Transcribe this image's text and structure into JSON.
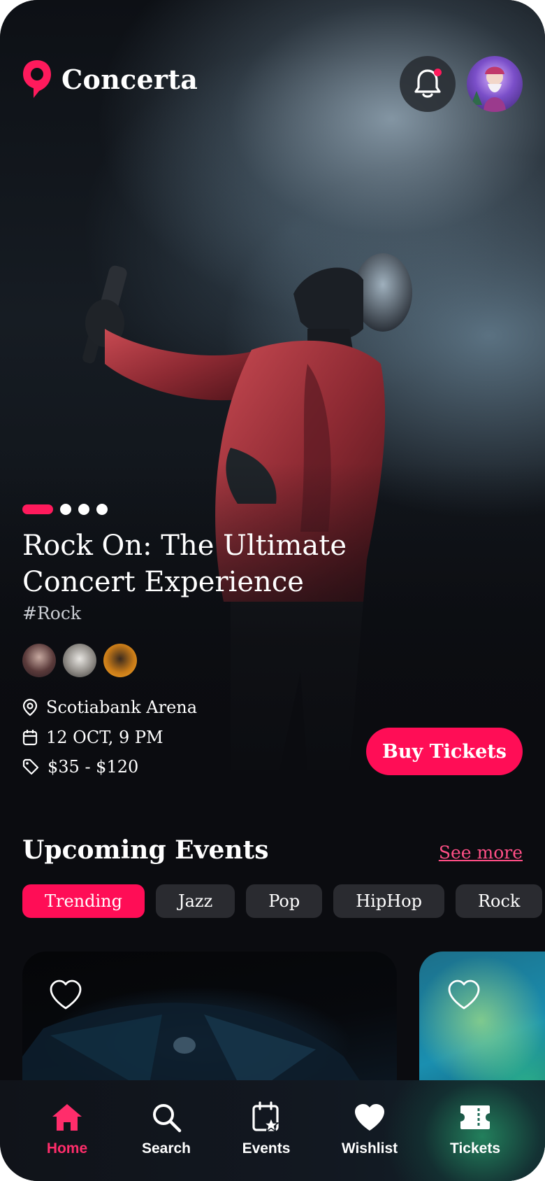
{
  "app": {
    "name": "Concerta"
  },
  "header": {
    "notification_icon": "bell-icon",
    "has_unread": true,
    "profile_icon": "avatar"
  },
  "hero": {
    "slides_total": 4,
    "active_slide": 1,
    "title": "Rock On: The Ultimate Concert Experience",
    "tag": "#Rock",
    "artists": [
      "artist-avatar",
      "artist-avatar",
      "artist-avatar"
    ],
    "venue": "Scotiabank Arena",
    "datetime": "12 OCT, 9 PM",
    "price": "$35 - $120",
    "buy_label": "Buy Tickets"
  },
  "upcoming": {
    "title": "Upcoming Events",
    "see_more": "See more",
    "categories": [
      {
        "label": "Trending",
        "active": true
      },
      {
        "label": "Jazz",
        "active": false
      },
      {
        "label": "Pop",
        "active": false
      },
      {
        "label": "HipHop",
        "active": false
      },
      {
        "label": "Rock",
        "active": false
      }
    ]
  },
  "tabbar": {
    "items": [
      {
        "label": "Home",
        "icon": "home-icon",
        "active": true
      },
      {
        "label": "Search",
        "icon": "search-icon",
        "active": false
      },
      {
        "label": "Events",
        "icon": "calendar-star-icon",
        "active": false
      },
      {
        "label": "Wishlist",
        "icon": "heart-icon",
        "active": false
      },
      {
        "label": "Tickets",
        "icon": "ticket-icon",
        "active": false
      }
    ]
  },
  "colors": {
    "accent": "#ff0d56",
    "background": "#0b0c10",
    "chip": "#2a2b30"
  }
}
